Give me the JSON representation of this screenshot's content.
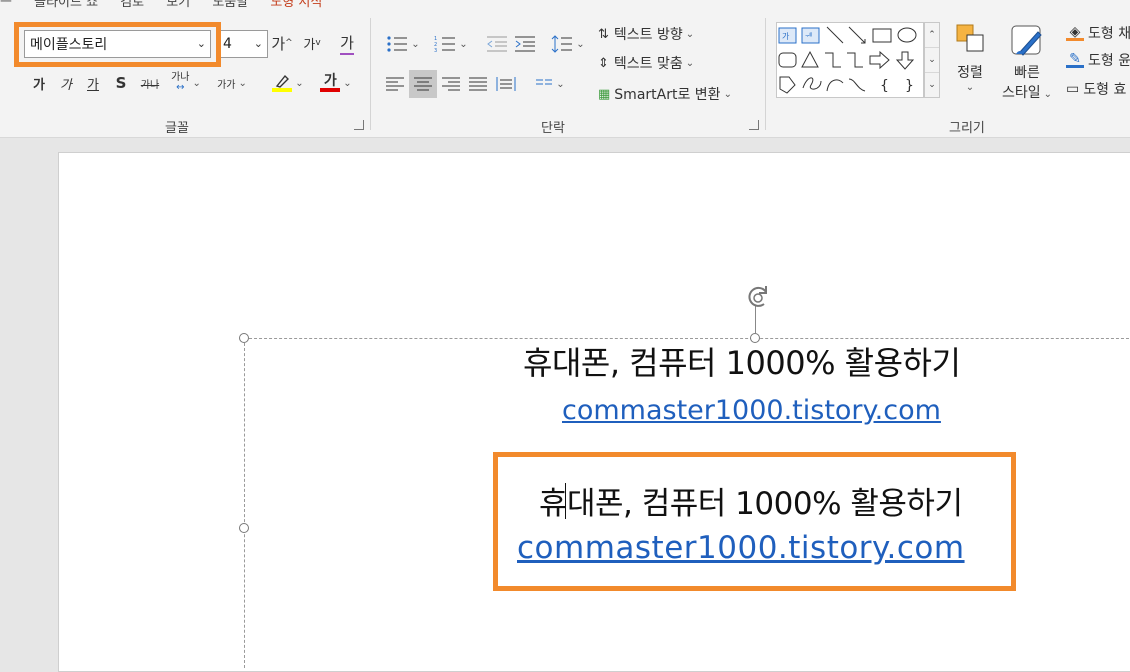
{
  "tabs": [
    {
      "label": "슬라이드 쇼"
    },
    {
      "label": "검토"
    },
    {
      "label": "보기"
    },
    {
      "label": "도움말"
    },
    {
      "label": "도형 서식"
    }
  ],
  "font": {
    "family_value": "메이플스토리",
    "size_value": "4",
    "grow_label": "가",
    "shrink_label": "가",
    "clear_label": "가",
    "bold_label": "가",
    "italic_label": "가",
    "underline_label": "가",
    "shadow_label": "S",
    "strike_label": "가나",
    "spacing_label": "가나",
    "case_label": "가가",
    "highlight_label": "",
    "color_label": "가",
    "group_label": "글꼴"
  },
  "paragraph": {
    "text_direction_label": "텍스트 방향",
    "align_text_label": "텍스트 맞춤",
    "smartart_label": "SmartArt로 변환",
    "group_label": "단락"
  },
  "drawing": {
    "arrange_label": "정렬",
    "quick_styles_label_1": "빠른",
    "quick_styles_label_2": "스타일",
    "shape_fill_label": "도형 채",
    "shape_outline_label": "도형 윤",
    "shape_effects_label": "도형 효",
    "group_label": "그리기",
    "shape_icons": [
      "textbox-icon",
      "vertical-textbox-icon",
      "line-icon",
      "arrow-line-icon",
      "rectangle-icon",
      "oval-icon",
      "rounded-rectangle-icon",
      "triangle-icon",
      "elbow-connector-icon",
      "elbow-arrow-icon",
      "right-arrow-icon",
      "down-arrow-icon",
      "freeform-icon",
      "scribble-icon",
      "arc-icon",
      "curve-icon",
      "left-brace-icon",
      "right-brace-icon"
    ],
    "shape_chars_row3": [
      "{",
      "}"
    ]
  },
  "slide": {
    "line1": "휴대폰, 컴퓨터 1000% 활용하기",
    "line2": "commaster1000.tistory.com",
    "line3": "휴대폰, 컴퓨터 1000% 활용하기",
    "line4": "commaster1000.tistory.com"
  },
  "colors": {
    "highlight_orange": "#f28a2c",
    "link_blue": "#1f5fbd",
    "font_color_red": "#e00000",
    "highlighter_yellow": "#ffff00"
  }
}
